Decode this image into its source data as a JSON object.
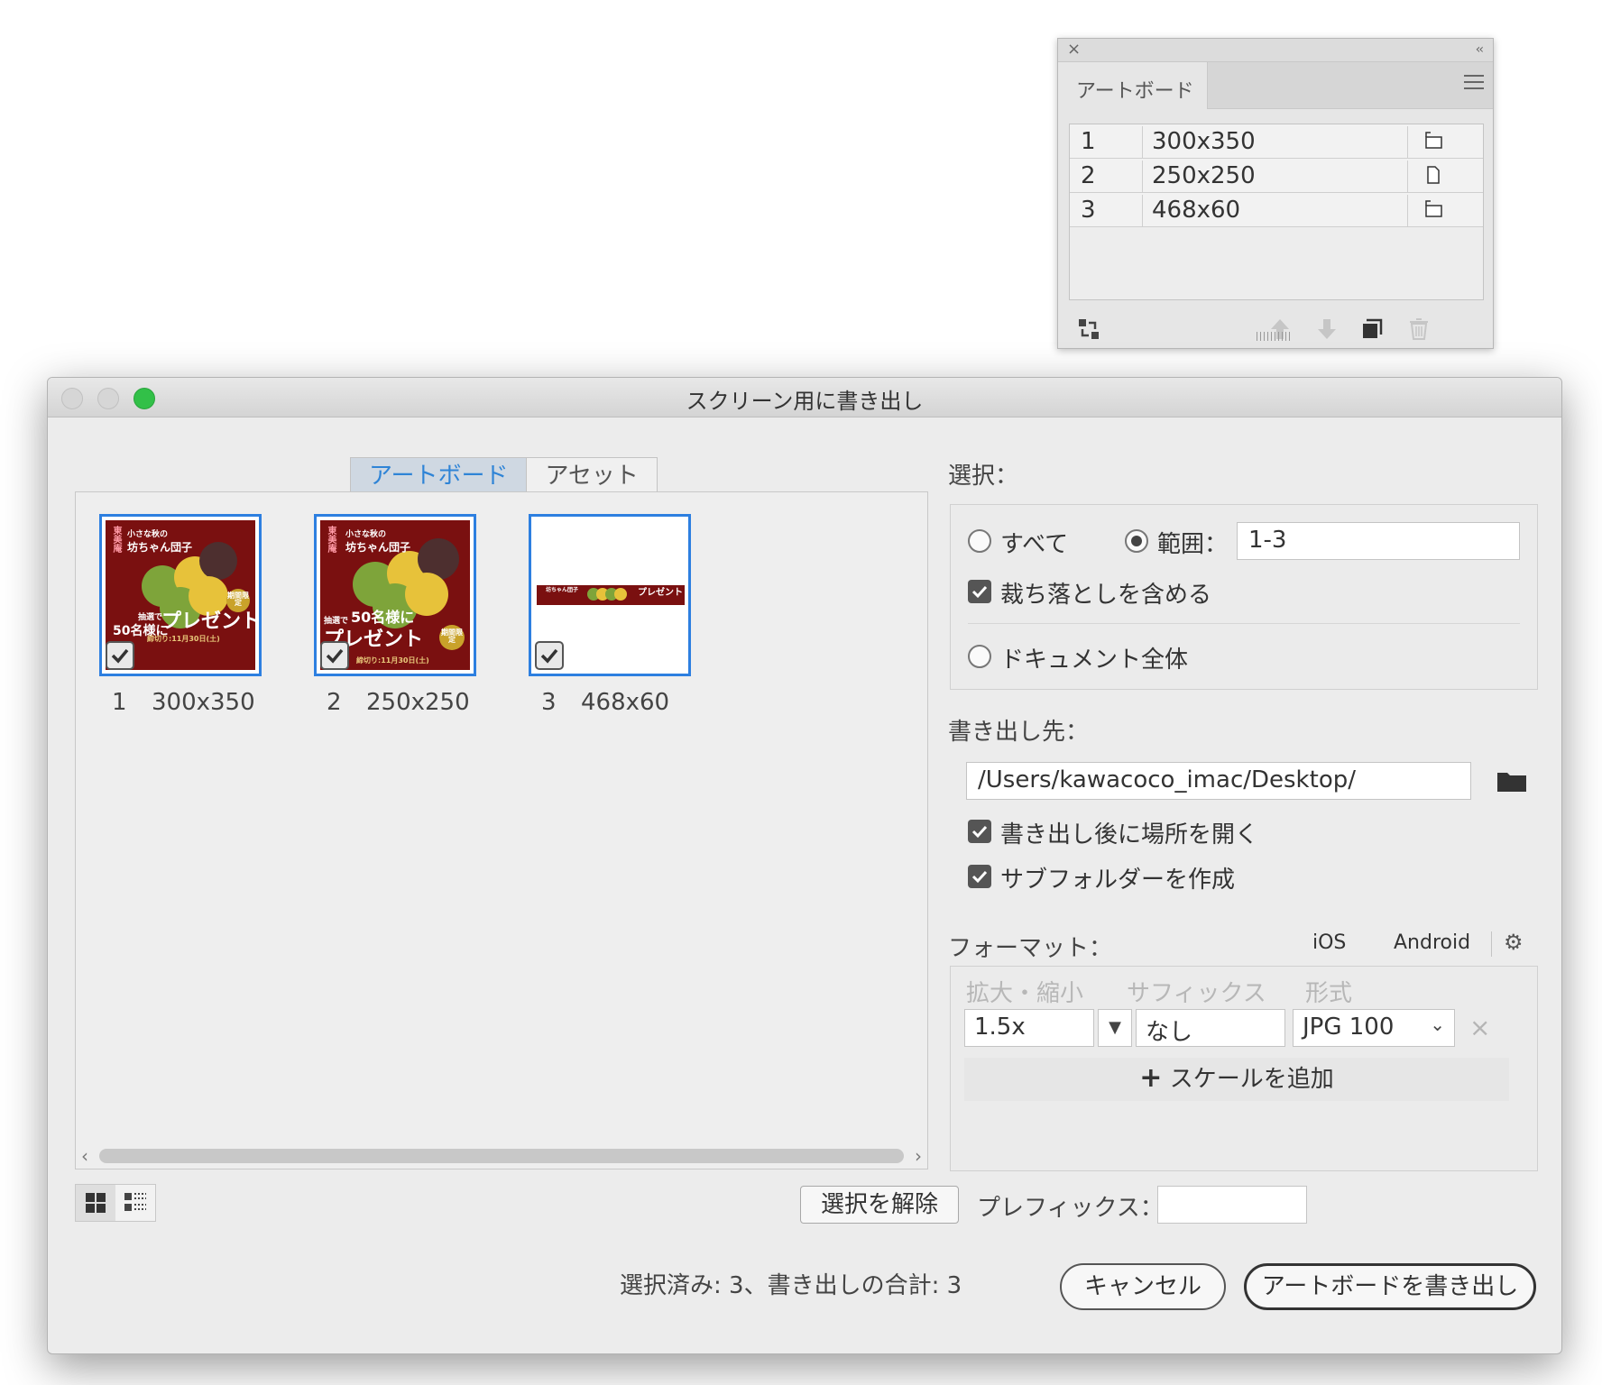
{
  "artboard_panel": {
    "tab": "アートボード",
    "rows": [
      {
        "num": "1",
        "name": "300x350"
      },
      {
        "num": "2",
        "name": "250x250"
      },
      {
        "num": "3",
        "name": "468x60"
      }
    ]
  },
  "dialog": {
    "title": "スクリーン用に書き出し",
    "tabs": {
      "artboard": "アートボード",
      "asset": "アセット"
    },
    "thumbnails": [
      {
        "num": "1",
        "size": "300x350",
        "checked": true
      },
      {
        "num": "2",
        "size": "250x250",
        "checked": true
      },
      {
        "num": "3",
        "size": "468x60",
        "checked": true
      }
    ],
    "thumb_art": {
      "brand": "東美庵",
      "line1": "小さな秋の",
      "line2": "坊ちゃん団子",
      "badge": "期間限定",
      "lottery": "抽選で",
      "present_a": "50名様に",
      "present_b": "プレゼント",
      "deadline": "締切り:11月30日(土)"
    },
    "selection": {
      "label": "選択：",
      "all": "すべて",
      "range": "範囲：",
      "range_value": "1-3",
      "include_bleed": "裁ち落としを含める",
      "whole_document": "ドキュメント全体"
    },
    "export_to": {
      "label": "書き出し先：",
      "path": "/Users/kawacoco_imac/Desktop/",
      "open_after": "書き出し後に場所を開く",
      "create_subfolder": "サブフォルダーを作成"
    },
    "format": {
      "label": "フォーマット：",
      "ios": "iOS",
      "android": "Android",
      "col_scale": "拡大・縮小",
      "col_suffix": "サフィックス",
      "col_format": "形式",
      "scale_value": "1.5x",
      "suffix_value": "なし",
      "format_value": "JPG 100",
      "add_scale": "スケールを追加"
    },
    "deselect": "選択を解除",
    "prefix_label": "プレフィックス：",
    "status": "選択済み: 3、書き出しの合計: 3",
    "cancel": "キャンセル",
    "export_button": "アートボードを書き出し"
  },
  "colors": {
    "accent": "#2d7fe0",
    "window_green": "#32c048",
    "art_red": "#7a1010"
  }
}
